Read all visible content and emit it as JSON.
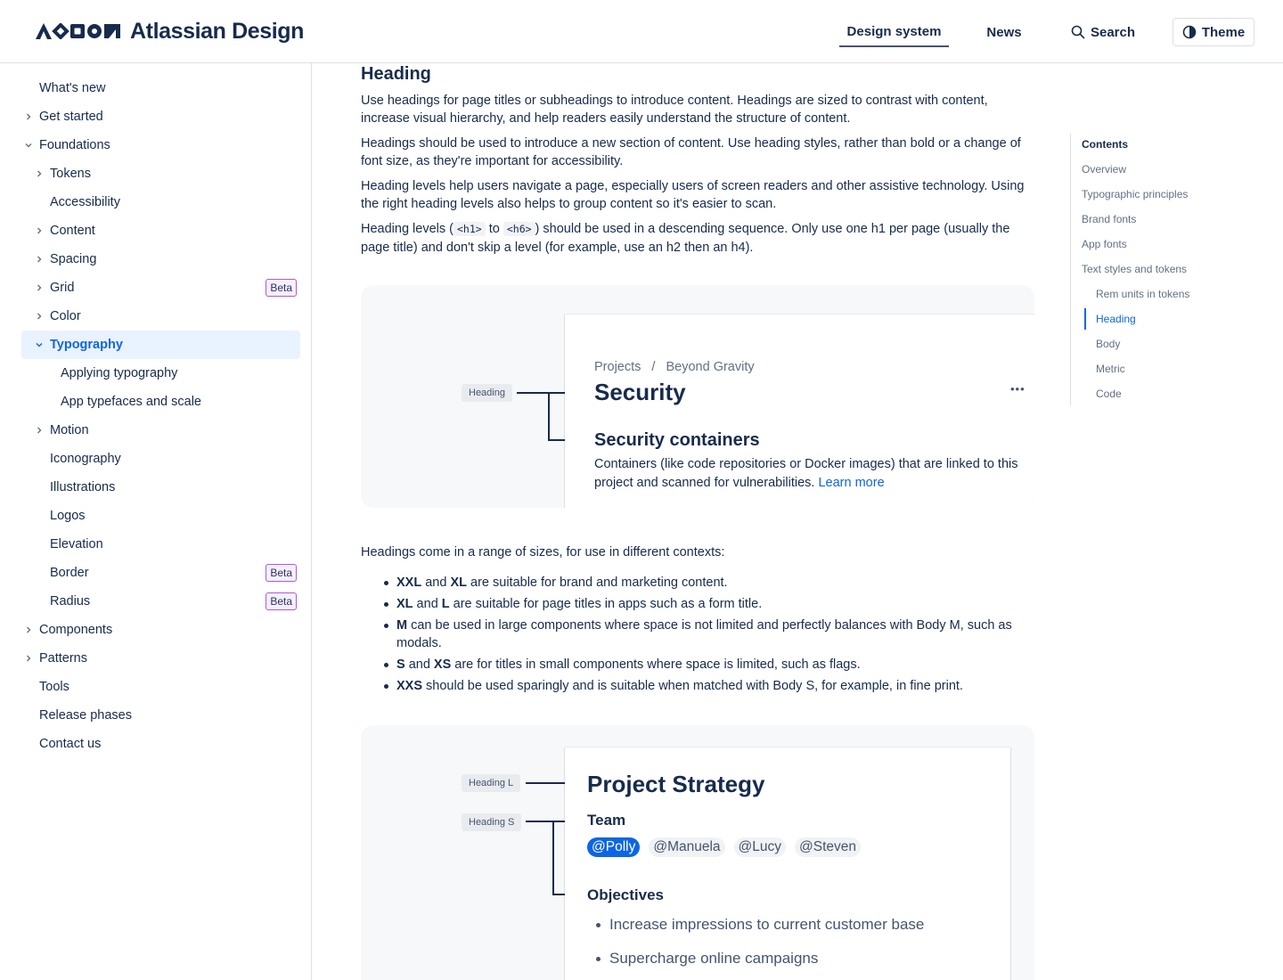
{
  "header": {
    "logo_text": "Atlassian Design",
    "nav": {
      "design_system": "Design system",
      "news": "News",
      "search": "Search",
      "theme": "Theme"
    }
  },
  "sidebar": {
    "items": [
      {
        "label": "What's new"
      },
      {
        "label": "Get started"
      },
      {
        "label": "Foundations"
      },
      {
        "label": "Tokens"
      },
      {
        "label": "Accessibility"
      },
      {
        "label": "Content"
      },
      {
        "label": "Spacing"
      },
      {
        "label": "Grid",
        "badge": "Beta"
      },
      {
        "label": "Color"
      },
      {
        "label": "Typography"
      },
      {
        "label": "Applying typography"
      },
      {
        "label": "App typefaces and scale"
      },
      {
        "label": "Motion"
      },
      {
        "label": "Iconography"
      },
      {
        "label": "Illustrations"
      },
      {
        "label": "Logos"
      },
      {
        "label": "Elevation"
      },
      {
        "label": "Border",
        "badge": "Beta"
      },
      {
        "label": "Radius",
        "badge": "Beta"
      },
      {
        "label": "Components"
      },
      {
        "label": "Patterns"
      },
      {
        "label": "Tools"
      },
      {
        "label": "Release phases"
      },
      {
        "label": "Contact us"
      }
    ]
  },
  "content": {
    "title": "Heading",
    "p1": "Use headings for page titles or subheadings to introduce content. Headings are sized to contrast with content, increase visual hierarchy, and help readers easily understand the structure of content.",
    "p2": "Headings should be used to introduce a new section of content. Use heading styles, rather than bold or a change of font size, as they're important for accessibility.",
    "p3": "Heading levels help users navigate a page, especially users of screen readers and other assistive technology. Using the right heading levels also helps to group content so it's easier to scan.",
    "p4_a": "Heading levels (",
    "p4_code1": "<h1>",
    "p4_b": " to ",
    "p4_code2": "<h6>",
    "p4_c": ") should be used in a descending sequence. Only use one h1 per page (usually the page title) and don't skip a level (for example, use an h2 then an h4).",
    "demo1": {
      "tag": "Heading",
      "breadcrumb_1": "Projects",
      "breadcrumb_sep": "/",
      "breadcrumb_2": "Beyond Gravity",
      "title": "Security",
      "more": "•••",
      "subtitle": "Security containers",
      "body": "Containers (like code repositories or Docker images) that are linked to this project and scanned for vulnerabilities.",
      "link": "Learn more"
    },
    "sizes_intro": "Headings come in a range of sizes, for use in different contexts:",
    "bullets": [
      {
        "b1": "XXL",
        "m1": " and ",
        "b2": "XL",
        "rest": " are suitable for brand and marketing content."
      },
      {
        "b1": "XL",
        "m1": " and ",
        "b2": "L",
        "rest": " are suitable for page titles in apps such as a form title."
      },
      {
        "b1": "M",
        "m1": "",
        "b2": "",
        "rest": " can be used in large components where space is not limited and perfectly balances with Body M, such as modals."
      },
      {
        "b1": "S",
        "m1": " and ",
        "b2": "XS",
        "rest": " are for titles in small components where space is limited, such as flags."
      },
      {
        "b1": "XXS",
        "m1": "",
        "b2": "",
        "rest": " should be used sparingly and is suitable when matched with Body S, for example, in fine print."
      }
    ],
    "demo2": {
      "tag_l": "Heading L",
      "tag_s": "Heading S",
      "title": "Project Strategy",
      "team": "Team",
      "mentions": [
        "@Polly",
        "@Manuela",
        "@Lucy",
        "@Steven"
      ],
      "objectives": "Objectives",
      "obj_items": [
        "Increase impressions to current customer base",
        "Supercharge online campaigns"
      ]
    }
  },
  "toc": {
    "title": "Contents",
    "items": [
      "Overview",
      "Typographic principles",
      "Brand fonts",
      "App fonts",
      "Text styles and tokens",
      "Rem units in tokens",
      "Heading",
      "Body",
      "Metric",
      "Code"
    ]
  },
  "colors": {
    "accent": "#0c66e4",
    "text": "#172b4d",
    "beta_border": "#af59e1"
  }
}
